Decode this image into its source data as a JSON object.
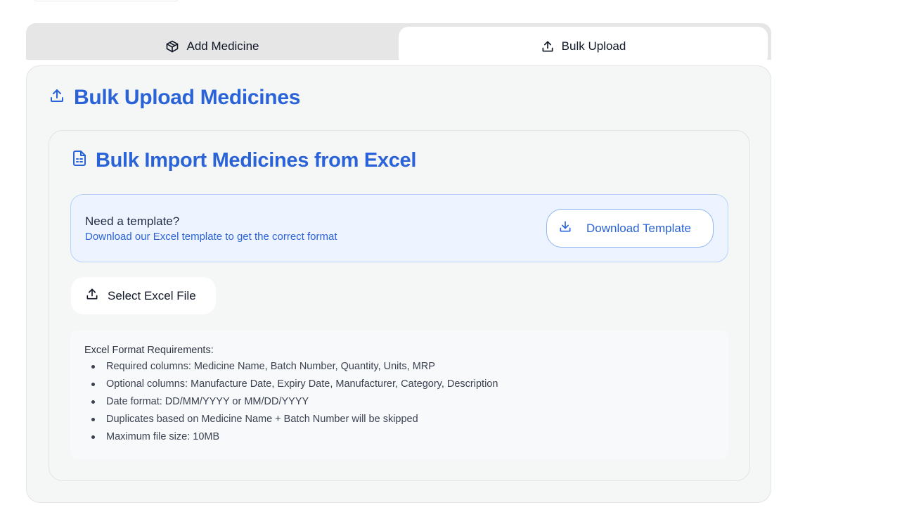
{
  "tabs": [
    {
      "label": "Add Medicine",
      "icon": "box-icon",
      "active": false
    },
    {
      "label": "Bulk Upload",
      "icon": "upload-icon",
      "active": true
    }
  ],
  "panel": {
    "title": "Bulk Upload Medicines",
    "title_icon": "upload-icon"
  },
  "card": {
    "title": "Bulk Import Medicines from Excel",
    "title_icon": "document-icon",
    "template": {
      "heading": "Need a template?",
      "subtext": "Download our Excel template to get the correct format",
      "button_label": "Download Template",
      "button_icon": "download-icon"
    },
    "select_button_label": "Select Excel File",
    "select_button_icon": "upload-icon",
    "requirements": {
      "title": "Excel Format Requirements:",
      "items": [
        "Required columns: Medicine Name, Batch Number, Quantity, Units, MRP",
        "Optional columns: Manufacture Date, Expiry Date, Manufacturer, Category, Description",
        "Date format: DD/MM/YYYY or MM/DD/YYYY",
        "Duplicates based on Medicine Name + Batch Number will be skipped",
        "Maximum file size: 10MB"
      ]
    }
  },
  "colors": {
    "accent": "#2a63d8",
    "template_bg": "#eef4ff",
    "template_border": "#b8d2fa",
    "panel_bg": "#f5f6f6",
    "tab_bar_bg": "#e6e6e6"
  }
}
